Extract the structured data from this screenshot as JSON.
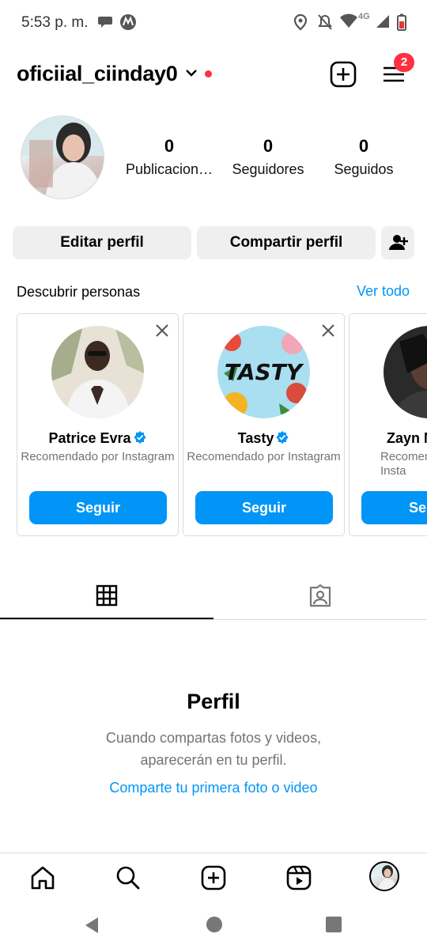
{
  "status_bar": {
    "time": "5:53 p. m.",
    "network": "4G",
    "icons": [
      "chat-bubble-icon",
      "motorola-icon",
      "location-icon",
      "mute-icon",
      "wifi-icon",
      "signal-icon",
      "battery-icon"
    ]
  },
  "header": {
    "username": "oficiial_ciinday0",
    "menu_badge": "2",
    "icons": [
      "chevron-down-icon",
      "add-post-icon",
      "menu-icon"
    ]
  },
  "profile": {
    "stats": [
      {
        "value": "0",
        "label": "Publicacion…"
      },
      {
        "value": "0",
        "label": "Seguidores"
      },
      {
        "value": "0",
        "label": "Seguidos"
      }
    ]
  },
  "actions": {
    "edit_label": "Editar perfil",
    "share_label": "Compartir perfil"
  },
  "discover": {
    "title": "Descubrir personas",
    "see_all": "Ver todo",
    "cards": [
      {
        "name": "Patrice Evra",
        "subtitle": "Recomendado por Instagram",
        "button": "Seguir"
      },
      {
        "name": "Tasty",
        "subtitle": "Recomendado por Instagram",
        "button": "Seguir"
      },
      {
        "name": "Zayn M",
        "subtitle": "Recomen Insta",
        "button": "Se"
      }
    ]
  },
  "tabs": [
    "grid-icon",
    "tagged-icon"
  ],
  "empty_state": {
    "title": "Perfil",
    "line1": "Cuando compartas fotos y videos,",
    "line2": "aparecerán en tu perfil.",
    "link": "Comparte tu primera foto o video"
  },
  "bottom_nav": [
    "home-icon",
    "search-icon",
    "create-icon",
    "reels-icon",
    "profile-avatar"
  ],
  "colors": {
    "accent": "#0095f6",
    "notification": "#ff3040",
    "button_bg": "#efefef",
    "muted_text": "#737373"
  }
}
